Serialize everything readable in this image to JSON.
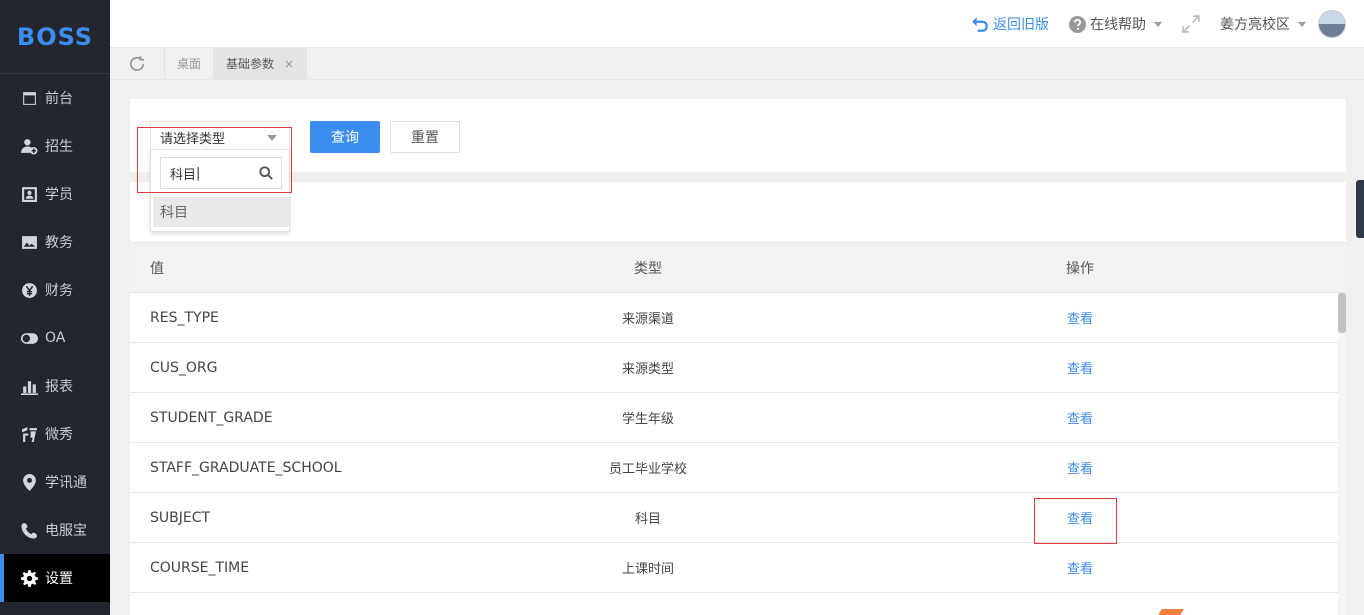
{
  "logo": "BOSS",
  "sidebar": {
    "items": [
      {
        "label": "前台",
        "icon": "calendar-icon"
      },
      {
        "label": "招生",
        "icon": "user-add-icon"
      },
      {
        "label": "学员",
        "icon": "id-card-icon"
      },
      {
        "label": "教务",
        "icon": "image-icon"
      },
      {
        "label": "财务",
        "icon": "yen-icon"
      },
      {
        "label": "OA",
        "icon": "toggle-icon"
      },
      {
        "label": "报表",
        "icon": "bar-chart-icon"
      },
      {
        "label": "微秀",
        "icon": "xiu-icon"
      },
      {
        "label": "学讯通",
        "icon": "location-icon"
      },
      {
        "label": "电服宝",
        "icon": "phone-icon"
      },
      {
        "label": "设置",
        "icon": "gear-icon",
        "active": true
      }
    ]
  },
  "header": {
    "back_label": "返回旧版",
    "help_label": "在线帮助",
    "campus_label": "姜方亮校区"
  },
  "tabs": [
    {
      "label": "桌面",
      "active": false
    },
    {
      "label": "基础参数",
      "active": true,
      "close": "×"
    }
  ],
  "filter": {
    "select_placeholder": "请选择类型",
    "search_value": "科目",
    "option": "科目",
    "query_label": "查询",
    "reset_label": "重置"
  },
  "table": {
    "headers": {
      "value": "值",
      "type": "类型",
      "action": "操作"
    },
    "rows": [
      {
        "value": "RES_TYPE",
        "type": "来源渠道",
        "action": "查看"
      },
      {
        "value": "CUS_ORG",
        "type": "来源类型",
        "action": "查看"
      },
      {
        "value": "STUDENT_GRADE",
        "type": "学生年级",
        "action": "查看"
      },
      {
        "value": "STAFF_GRADUATE_SCHOOL",
        "type": "员工毕业学校",
        "action": "查看"
      },
      {
        "value": "SUBJECT",
        "type": "科目",
        "action": "查看"
      },
      {
        "value": "COURSE_TIME",
        "type": "上课时间",
        "action": "查看"
      }
    ]
  },
  "colors": {
    "accent": "#3b8df0",
    "sidebar_bg": "#23262e",
    "highlight_box": "#e03a3a"
  }
}
